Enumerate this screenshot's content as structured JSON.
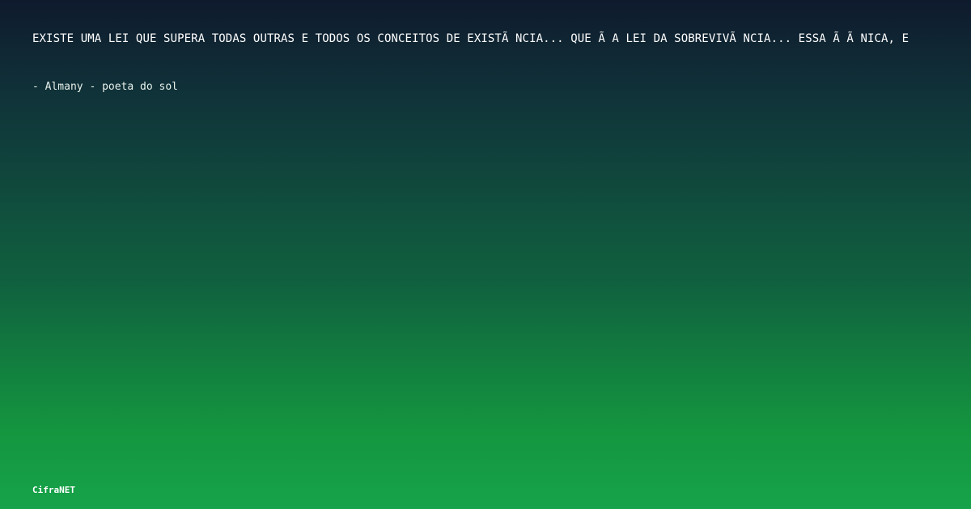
{
  "quote": {
    "text": "EXISTE UMA LEI QUE SUPERA TODAS OUTRAS E TODOS OS CONCEITOS DE EXISTÃ NCIA... QUE Ã  A LEI DA SOBREVIVÃ NCIA... ESSA Ã  Ã NICA, E"
  },
  "author": {
    "text": "- Almany - poeta do sol"
  },
  "brand": {
    "name": "CifraNET"
  },
  "colors": {
    "gradient_top": "#0f1a2d",
    "gradient_bottom": "#16a34a",
    "text": "#ffffff"
  }
}
